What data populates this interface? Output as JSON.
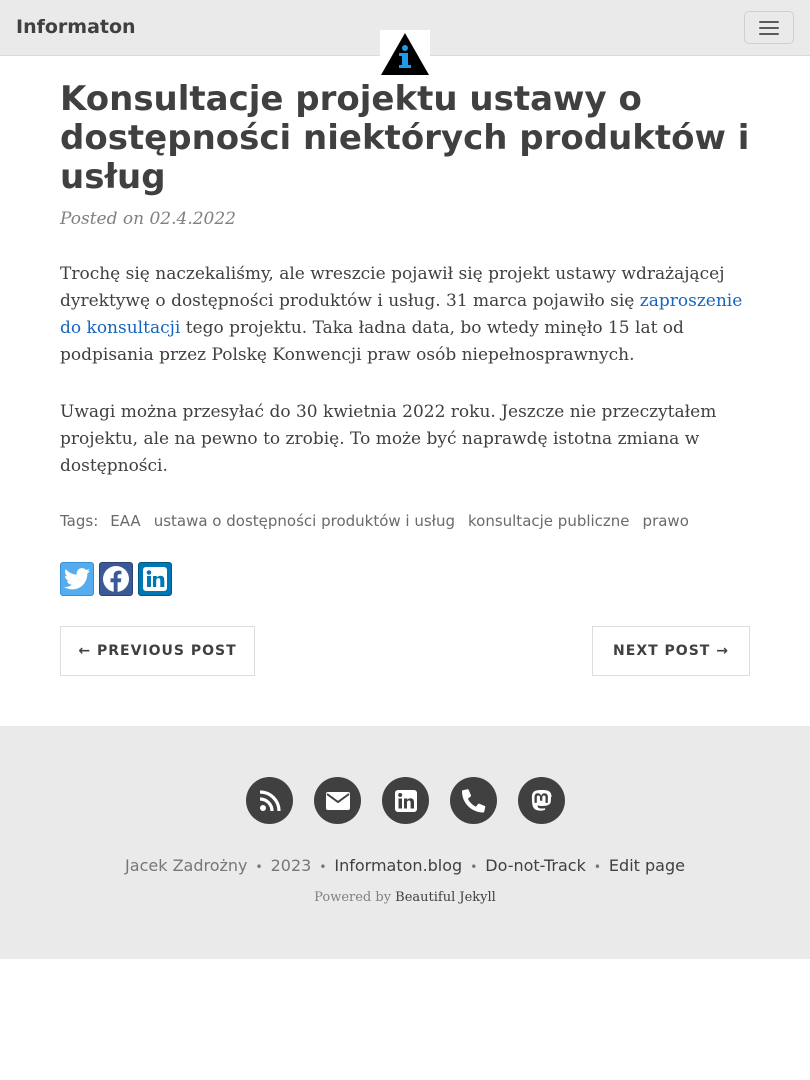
{
  "nav": {
    "brand": "Informaton",
    "menu_icon": "hamburger-icon",
    "logo_icon": "info-triangle-icon"
  },
  "post": {
    "title": "Konsultacje projektu ustawy o dostępności niektórych produktów i usług",
    "meta": "Posted on 02.4.2022",
    "p1_before": "Trochę się naczekaliśmy, ale wreszcie pojawił się projekt ustawy wdrażającej dyrektywę o dostępności produktów i usług. 31 marca pojawiło się ",
    "p1_link": "zaproszenie do konsultacji",
    "p1_after": " tego projektu. Taka ładna data, bo wtedy minęło 15 lat od podpisania przez Polskę Konwencji praw osób niepełnosprawnych.",
    "p2": "Uwagi można przesyłać do 30 kwietnia 2022 roku. Jeszcze nie przeczytałem projektu, ale na pewno to zrobię. To może być naprawdę istotna zmiana w dostępności."
  },
  "tags": {
    "label": "Tags:",
    "items": [
      "EAA",
      "ustawa o dostępności produktów i usług",
      "konsultacje publiczne",
      "prawo"
    ]
  },
  "share": {
    "icons": [
      "twitter-icon",
      "facebook-icon",
      "linkedin-icon"
    ],
    "colors": {
      "twitter": "#55acee",
      "facebook": "#3b5998",
      "linkedin": "#0077b5"
    }
  },
  "pager": {
    "previous": "← PREVIOUS POST",
    "next": "NEXT POST →"
  },
  "footer": {
    "social_icons": [
      "rss-icon",
      "email-icon",
      "linkedin-icon",
      "phone-icon",
      "mastodon-icon"
    ],
    "author": "Jacek Zadrożny",
    "year": "2023",
    "site": "Informaton.blog",
    "dnt": "Do-not-Track",
    "edit": "Edit page",
    "powered_prefix": "Powered by ",
    "powered_link": "Beautiful Jekyll"
  }
}
